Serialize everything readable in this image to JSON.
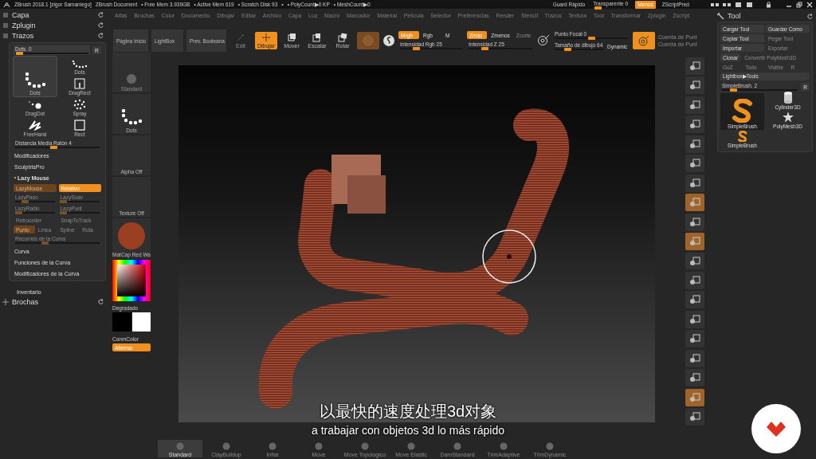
{
  "title_bar": {
    "title": "ZBrush 2018.1 [zigor Samaniego]",
    "document": "ZBrush Document",
    "stats": [
      "• Free Mem 3.939GB",
      "• Active Mem 619",
      "• Scratch Disk 93",
      "•",
      "• PolyCount▶0 KP",
      "• MeshCount▶0"
    ],
    "quick_save": "Guard Rápido",
    "transparency": {
      "label": "Transparente 0",
      "level": 0.12
    },
    "menus_button": {
      "label": "Menús",
      "on": true
    },
    "zscript": "ZScriptPred"
  },
  "menu_bar": [
    "Alfas",
    "Brochas",
    "Color",
    "Documento",
    "Dibujar",
    "Editar",
    "Archivo",
    "Capa",
    "Luz",
    "Macro",
    "Marcador",
    "Material",
    "Película",
    "Selector",
    "Preferencias",
    "Render",
    "Stencil",
    "Trazos",
    "Textura",
    "Tool",
    "Transformar",
    "Zplugin",
    "Zscript"
  ],
  "left_palettes": [
    {
      "label": "Capa"
    },
    {
      "label": "Zplugin"
    },
    {
      "label": "Trazos"
    }
  ],
  "stroke_panel": {
    "stroke_slider": {
      "label": "Dots. 0",
      "level": 0.05
    },
    "reset": "R",
    "strokes": [
      {
        "label": "Dots",
        "kind": "dots",
        "selected": false
      },
      {
        "label": "Dots",
        "kind": "dots",
        "selected": true
      },
      {
        "label": "DragRect",
        "kind": "dragrect",
        "selected": false
      },
      {
        "label": "DragDot",
        "kind": "dragdot",
        "selected": false
      },
      {
        "label": "Spray",
        "kind": "spray",
        "selected": false
      },
      {
        "label": "FreeHand",
        "kind": "freehand",
        "selected": false
      },
      {
        "label": "Rect",
        "kind": "rect",
        "selected": false
      }
    ],
    "mouse_avg": {
      "label": "Distancia Media Ratón 4",
      "level": 0.45
    },
    "sections": [
      {
        "label": "Modificadores",
        "expanded": false
      },
      {
        "label": "SculptrisPro",
        "expanded": false
      },
      {
        "label": "Lazy Mouse",
        "expanded": true
      }
    ],
    "lazy_buttons": [
      {
        "label": "LazyMouse",
        "on": true,
        "disabled": true
      },
      {
        "label": "Relativo",
        "on": true,
        "disabled": false
      }
    ],
    "lazy_sliders": [
      {
        "label": "LazyPaso",
        "level": 0.25,
        "disabled": true
      },
      {
        "label": "LazySuav",
        "level": 0.08,
        "disabled": true
      },
      {
        "label": "LazyRadio",
        "level": 0.08,
        "disabled": true
      },
      {
        "label": "LazyPunt",
        "level": 0.08,
        "disabled": true
      }
    ],
    "lazy_toggles": [
      {
        "label": "Retroceder",
        "disabled": true
      },
      {
        "label": "SnapToTrack",
        "disabled": true
      }
    ],
    "lazy_modes": [
      {
        "label": "Punto",
        "selected": true,
        "disabled": true
      },
      {
        "label": "Línea",
        "selected": false,
        "disabled": true
      },
      {
        "label": "Spline",
        "selected": false,
        "disabled": true
      },
      {
        "label": "Ruta",
        "selected": false,
        "disabled": true
      }
    ],
    "curve_step": {
      "label": "Recorrido de la Curva",
      "level": 0.35,
      "disabled": true
    },
    "curve_sections": [
      "Curva",
      "Funciones de la Curva",
      "Modificadores de la Curva"
    ]
  },
  "inventory": "Inventario",
  "brushes_palette": {
    "label": "Brochas"
  },
  "quick_column": {
    "brush": "Standard",
    "stroke": "Dots",
    "alpha": "Alpha Off",
    "texture": "Texture Off",
    "material": "MatCap Red Wa",
    "gradient": "Degradado",
    "swatches": [
      {
        "color": "#000000"
      },
      {
        "color": "#ffffff"
      }
    ],
    "switch_color": "ConmColor",
    "alternate": "Alternar"
  },
  "toolbar": {
    "home": "Página Inicio",
    "lightbox": "LightBox",
    "boolean": "Prev. Booleana",
    "modes": [
      {
        "label": "Edit",
        "kind": "edit",
        "selected": false,
        "disabled": true
      },
      {
        "label": "Dibujar",
        "kind": "draw",
        "selected": true,
        "disabled": false
      },
      {
        "label": "Mover",
        "kind": "move",
        "selected": false,
        "disabled": false
      },
      {
        "label": "Escalar",
        "kind": "scale",
        "selected": false,
        "disabled": false
      },
      {
        "label": "Rotar",
        "kind": "rotate",
        "selected": false,
        "disabled": false
      }
    ],
    "rgb_buttons": [
      {
        "label": "Mrgb",
        "on": true,
        "disabled": false
      },
      {
        "label": "Rgb",
        "on": false,
        "disabled": false
      },
      {
        "label": "M",
        "on": false,
        "disabled": false
      }
    ],
    "rgb_intensity": {
      "label": "Intensidad Rgb 25",
      "level": 0.25
    },
    "z_buttons": [
      {
        "label": "Zmás",
        "on": true,
        "disabled": false
      },
      {
        "label": "Zmenos",
        "on": false,
        "disabled": false
      },
      {
        "label": "Zcorte",
        "on": false,
        "disabled": true
      }
    ],
    "z_intensity": {
      "label": "Intensidad Z 25",
      "level": 0.25
    },
    "focal": {
      "label": "Punto Focal 0",
      "level": 0.5
    },
    "draw_size": {
      "label": "Tamaño de dibujo 64",
      "level": 0.25
    },
    "dynamic": "Dynamic",
    "point_counts": [
      "Cuenta de Punt",
      "Cuenta de Punt"
    ]
  },
  "shelf": [
    {
      "on": false
    },
    {
      "on": false
    },
    {
      "on": false
    },
    {
      "on": false
    },
    {
      "on": false
    },
    {
      "on": false
    },
    {
      "on": false
    },
    {
      "on": true
    },
    {
      "on": false
    },
    {
      "on": true
    },
    {
      "on": false
    },
    {
      "on": false
    },
    {
      "on": false
    },
    {
      "on": false
    },
    {
      "on": false
    },
    {
      "on": false
    },
    {
      "on": false
    },
    {
      "on": true
    },
    {
      "on": false
    }
  ],
  "tool_panel": {
    "title": "Tool",
    "buttons": [
      {
        "label": "Cargar Tool",
        "disabled": false
      },
      {
        "label": "Guardar Como",
        "disabled": false
      },
      {
        "label": "Copiar Tool",
        "disabled": false
      },
      {
        "label": "Pegar Tool",
        "disabled": true
      },
      {
        "label": "Importar",
        "disabled": false
      },
      {
        "label": "Exportar",
        "disabled": true
      }
    ],
    "clone_row": [
      {
        "label": "Clonar",
        "disabled": false
      },
      {
        "label": "Convertir PolyMesh3D",
        "disabled": true
      }
    ],
    "goz_row": [
      {
        "label": "GoZ",
        "disabled": true
      },
      {
        "label": "Todo",
        "disabled": true
      },
      {
        "label": "Visible",
        "disabled": true
      },
      {
        "label": "R",
        "disabled": true
      }
    ],
    "lightbox": "Lightbox▶Tools",
    "current": {
      "label": "SimpleBrush. 2",
      "level": 0.15
    },
    "reset": "R",
    "tools": [
      {
        "label": "Cylinder3D",
        "kind": "cylinder",
        "selected": false
      },
      {
        "label": "SimpleBrush",
        "kind": "simplebrush",
        "selected": true
      },
      {
        "label": "PolyMesh3D",
        "kind": "polymesh",
        "selected": false
      },
      {
        "label": "SimpleBrush",
        "kind": "simplebrush",
        "selected": false
      }
    ]
  },
  "brush_strip": [
    {
      "label": "Standard",
      "selected": true
    },
    {
      "label": "ClayBuildup",
      "selected": false
    },
    {
      "label": "Inflat",
      "selected": false
    },
    {
      "label": "Move",
      "selected": false
    },
    {
      "label": "Move Topologico",
      "selected": false
    },
    {
      "label": "Move Elastic",
      "selected": false
    },
    {
      "label": "DamStandard",
      "selected": false
    },
    {
      "label": "TrimAdaptive",
      "selected": false
    },
    {
      "label": "TrimDynamic",
      "selected": false
    }
  ],
  "subtitles": [
    "以最快的速度处理3d对象",
    "a trabajar con objetos 3d lo más rápido"
  ]
}
